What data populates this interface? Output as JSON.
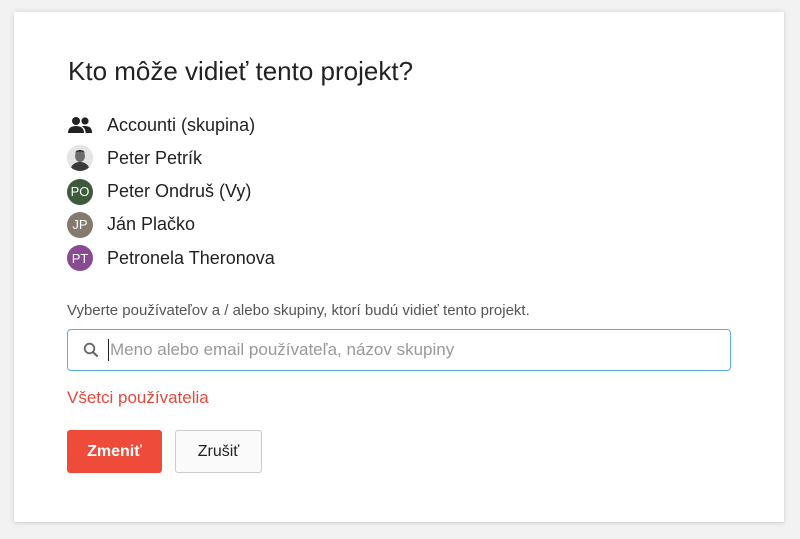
{
  "dialog": {
    "title": "Kto môže vidieť tento projekt?",
    "members": [
      {
        "name": "Accounti (skupina)",
        "avatar_type": "group",
        "avatar_icon": "group-icon"
      },
      {
        "name": "Peter Petrík",
        "avatar_type": "photo"
      },
      {
        "name": "Peter Ondruš (Vy)",
        "avatar_type": "initials",
        "initials": "PO",
        "color": "#3d5a3a"
      },
      {
        "name": "Ján Plačko",
        "avatar_type": "initials",
        "initials": "JP",
        "color": "#857a6e"
      },
      {
        "name": "Petronela Theronova",
        "avatar_type": "initials",
        "initials": "PT",
        "color": "#8a4a92"
      }
    ],
    "help_text": "Vyberte používateľov a / alebo skupiny, ktorí budú vidieť tento projekt.",
    "search": {
      "placeholder": "Meno alebo email používateľa, názov skupiny",
      "value": ""
    },
    "all_users_link": "Všetci používatelia",
    "buttons": {
      "confirm": "Zmeniť",
      "cancel": "Zrušiť"
    }
  },
  "colors": {
    "accent": "#ef4b3b",
    "link": "#e8473a",
    "focus_border": "#5aaee0"
  }
}
